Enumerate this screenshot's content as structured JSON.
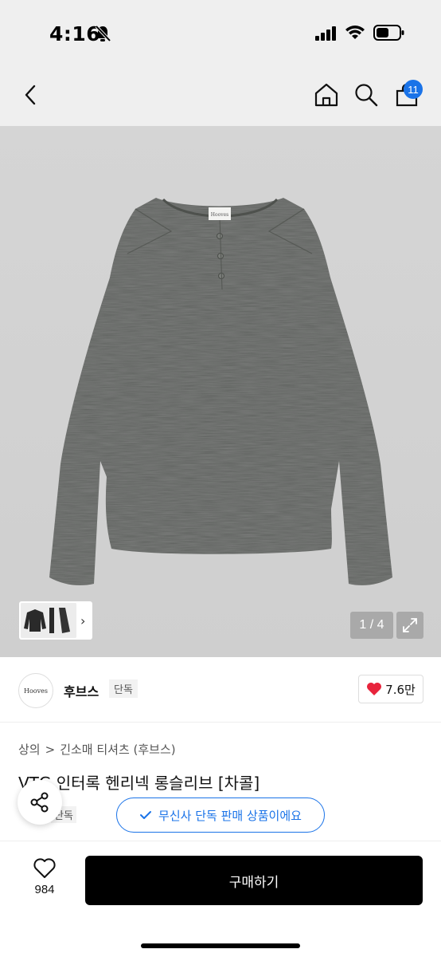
{
  "status_bar": {
    "time": "4:16"
  },
  "nav": {
    "cart_count": "11"
  },
  "gallery": {
    "counter": "1 / 4",
    "thumb_arrow": "›",
    "garment_label": "Hooves"
  },
  "brand": {
    "logo_text": "Hooves",
    "name": "후브스",
    "tag": "단독",
    "likes": "7.6만"
  },
  "breadcrumb": {
    "category": "상의",
    "separator": ">",
    "subcategory": "긴소매 티셔츠 (후브스)"
  },
  "product": {
    "title": "VTG 인터록 헨리넥 롱슬리브 [차콜]",
    "exclusive_tag": "단독",
    "exclusive_banner": "무신사 단독 판매 상품이에요"
  },
  "bottom_bar": {
    "wish_count": "984",
    "buy_label": "구매하기"
  },
  "colors": {
    "accent": "#1a73e8",
    "heart": "#e8243c",
    "garment": "#5f625e"
  }
}
